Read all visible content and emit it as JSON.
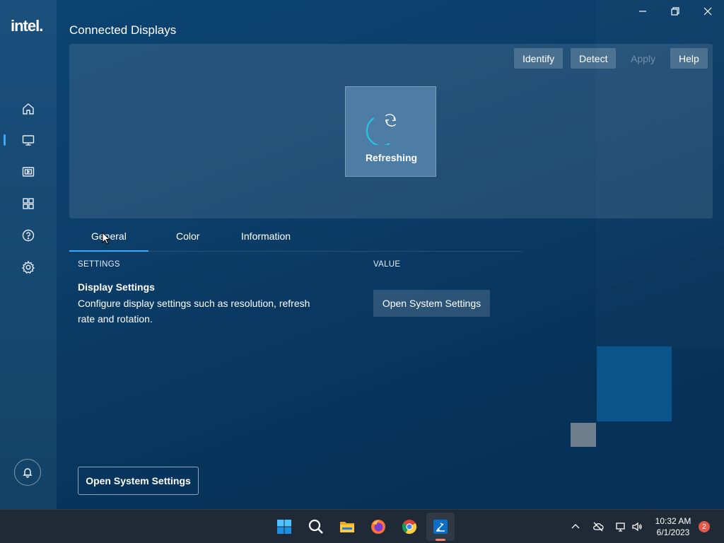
{
  "app": {
    "logo_text": "intel.",
    "page_title": "Connected Displays"
  },
  "sidebar": {
    "items": [
      {
        "name": "home",
        "icon": "home-icon"
      },
      {
        "name": "display",
        "icon": "monitor-icon",
        "active": true
      },
      {
        "name": "video",
        "icon": "video-icon"
      },
      {
        "name": "apps",
        "icon": "grid-icon"
      },
      {
        "name": "support",
        "icon": "help-icon"
      },
      {
        "name": "settings",
        "icon": "gear-icon"
      }
    ],
    "bell_icon": "bell-icon"
  },
  "toolbar": {
    "identify_label": "Identify",
    "detect_label": "Detect",
    "apply_label": "Apply",
    "help_label": "Help"
  },
  "refresh": {
    "label": "Refreshing"
  },
  "tabs": [
    {
      "label": "General",
      "active": true
    },
    {
      "label": "Color"
    },
    {
      "label": "Information"
    }
  ],
  "general": {
    "settings_header": "SETTINGS",
    "value_header": "VALUE",
    "setting_title": "Display Settings",
    "setting_description": "Configure display settings such as resolution, refresh rate and rotation.",
    "open_button_label": "Open System Settings"
  },
  "footer": {
    "open_button_label": "Open System Settings"
  },
  "taskbar": {
    "time": "10:32 AM",
    "date": "6/1/2023",
    "notification_count": "2",
    "apps": [
      "start-icon",
      "search-icon",
      "file-explorer-icon",
      "firefox-icon",
      "chrome-icon",
      "intel-graphics-icon"
    ]
  },
  "colors": {
    "accent": "#3aa8ff",
    "app_background": "#0b3d68",
    "taskbar": "#1f2a36",
    "badge": "#e05a4a"
  }
}
